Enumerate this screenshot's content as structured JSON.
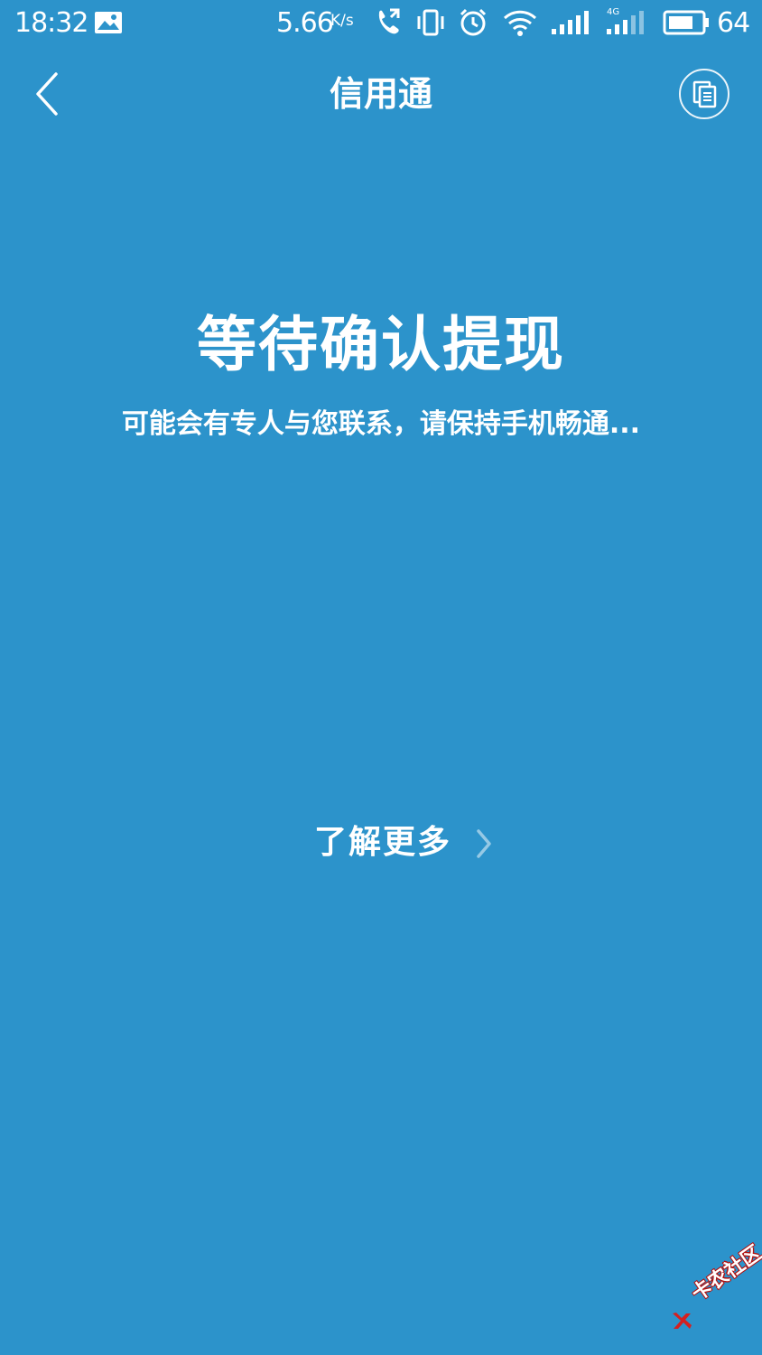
{
  "status_bar": {
    "time": "18:32",
    "net_speed": "5.66",
    "net_speed_unit": "K/s",
    "network_type": "4G",
    "battery_percent": "64",
    "icons": [
      "gallery-icon",
      "call-forward-icon",
      "vibrate-icon",
      "alarm-icon",
      "wifi-icon",
      "signal-icon",
      "signal-4g-icon",
      "battery-icon"
    ]
  },
  "nav": {
    "title": "信用通",
    "back_icon": "chevron-left-icon",
    "action_icon": "document-icon"
  },
  "main": {
    "headline": "等待确认提现",
    "subline": "可能会有专人与您联系，请保持手机畅通...",
    "more_label": "了解更多",
    "more_icon": "chevron-right-icon"
  },
  "watermark": {
    "text": "卡农社区"
  },
  "colors": {
    "background": "#2c93cb",
    "foreground": "#ffffff",
    "watermark_accent": "#d42020"
  }
}
